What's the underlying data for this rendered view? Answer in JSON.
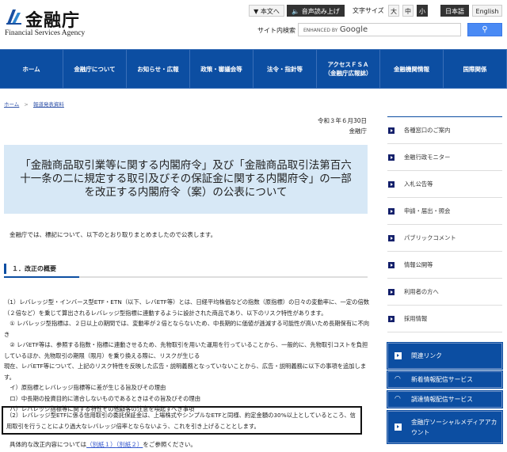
{
  "header": {
    "logo_jp": "金融庁",
    "logo_en": "Financial Services Agency",
    "skip_label": "▼ 本文へ",
    "speech_label": "🔈 音声読み上げ",
    "font_size_label": "文字サイズ",
    "font_sizes": [
      "大",
      "中",
      "小"
    ],
    "lang_ja": "日本語",
    "lang_en": "English",
    "search_label": "サイト内検索",
    "search_placeholder_prefix": "ENHANCED BY",
    "search_placeholder_brand": "Google"
  },
  "nav": [
    "ホーム",
    "金融庁について",
    "お知らせ・広報",
    "政策・審議会等",
    "法令・指針等",
    "アクセスＦＳＡ\n（金融庁広報誌）",
    "金融機関情報",
    "国際関係"
  ],
  "breadcrumb": {
    "home": "ホーム",
    "sep": ">",
    "current": "報道発表資料"
  },
  "date": "令和３年６月30日",
  "issuer": "金融庁",
  "title": "「金融商品取引業等に関する内閣府令」及び「金融商品取引法第百六十一条の二に規定する取引及びその保証金に関する内閣府令」の一部を改正する内閣府令（案）の公表について",
  "intro": "金融庁では、標記について、以下のとおり取りまとめましたので公表します。",
  "section_heading": "１．改正の概要",
  "paragraphs": [
    "（1）レバレッジ型・インバース型ETF・ETN（以下、レバETF等）とは、日経平均株価などの指数（原指標）の日々の変動率に、一定の倍数（２倍など）を乗じて算出されるレバレッジ型指標に連動するように設計された商品であり、以下のリスク特性があります。",
    "　① レバレッジ型指標は、２日以上の期間では、変動率が２倍とならないため、中長期的に価値が逓減する可能性が高いため長期保有に不向き",
    "　② レバETF等は、参照する指数・指標に連動させるため、先物取引を用いた運用を行っていることから、一般的に、先物取引コストを負担しているほか、先物取引の期限（限月）を乗り換える際に、リスクが生じる",
    "現在、レバETF等について、上記のリスク特性を反映した広告・説明義務となっていないことから、広告・説明義務に以下の事項を追加します。",
    "　イ）原指標とレバレッジ指標等に差が生じる旨及びその理由",
    "　ロ）中長期の投資目的に適合しないものであるときはその旨及びその理由",
    "　ハ）レバレッジ指標等に関する特性その他顧客の注意を喚起すべき事項"
  ],
  "boxed_paragraph": "（2）レバレッジ型ETFに係る信用取引の委託保証金は、上場株式やシンプルなETFと同様、約定金額の30%以上としているところ、信用取引を行うことにより過大なレバレッジ倍率とならないよう、これを引き上げることとします。",
  "closing": {
    "prefix": "具体的な改正内容については",
    "link1": "（別紙１）",
    "link2": "（別紙２）",
    "suffix": "をご参照ください。"
  },
  "sidebar": {
    "items": [
      "各種窓口のご案内",
      "金融行政モニター",
      "入札公告等",
      "申請・届出・照会",
      "パブリックコメント",
      "情報公開等",
      "利用者の方へ",
      "採用情報"
    ],
    "blue_links": [
      "関連リンク",
      "新着情報配信サービス",
      "調達情報配信サービス",
      "金融庁ソーシャルメディアアカウント"
    ]
  },
  "colors": {
    "brand_blue": "#0c4ea2",
    "title_bg": "#d7e8f6",
    "search_button": "#4a8af4"
  }
}
